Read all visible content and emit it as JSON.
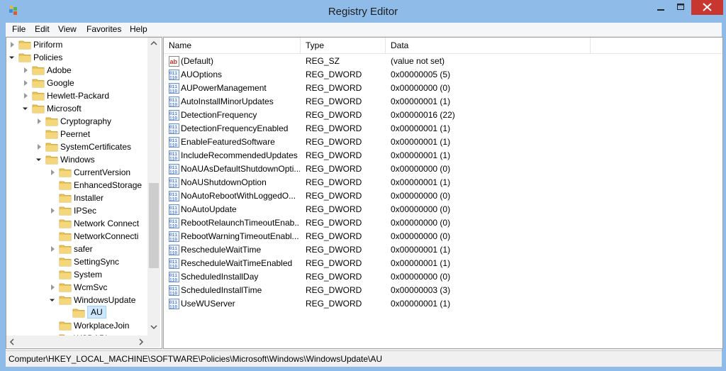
{
  "window": {
    "title": "Registry Editor"
  },
  "menu": [
    "File",
    "Edit",
    "View",
    "Favorites",
    "Help"
  ],
  "tree": [
    {
      "label": "Piriform",
      "state": "collapsed",
      "depth": 0
    },
    {
      "label": "Policies",
      "state": "expanded",
      "depth": 0
    },
    {
      "label": "Adobe",
      "state": "collapsed",
      "depth": 1
    },
    {
      "label": "Google",
      "state": "collapsed",
      "depth": 1
    },
    {
      "label": "Hewlett-Packard",
      "state": "collapsed",
      "depth": 1
    },
    {
      "label": "Microsoft",
      "state": "expanded",
      "depth": 1
    },
    {
      "label": "Cryptography",
      "state": "collapsed",
      "depth": 2
    },
    {
      "label": "Peernet",
      "state": "none",
      "depth": 2
    },
    {
      "label": "SystemCertificates",
      "state": "collapsed",
      "depth": 2
    },
    {
      "label": "Windows",
      "state": "expanded",
      "depth": 2
    },
    {
      "label": "CurrentVersion",
      "state": "collapsed",
      "depth": 3
    },
    {
      "label": "EnhancedStorage",
      "state": "none",
      "depth": 3
    },
    {
      "label": "Installer",
      "state": "none",
      "depth": 3
    },
    {
      "label": "IPSec",
      "state": "collapsed",
      "depth": 3
    },
    {
      "label": "Network Connect",
      "state": "none",
      "depth": 3
    },
    {
      "label": "NetworkConnecti",
      "state": "none",
      "depth": 3
    },
    {
      "label": "safer",
      "state": "collapsed",
      "depth": 3
    },
    {
      "label": "SettingSync",
      "state": "none",
      "depth": 3
    },
    {
      "label": "System",
      "state": "none",
      "depth": 3
    },
    {
      "label": "WcmSvc",
      "state": "collapsed",
      "depth": 3
    },
    {
      "label": "WindowsUpdate",
      "state": "expanded",
      "depth": 3
    },
    {
      "label": "AU",
      "state": "none",
      "depth": 4,
      "selected": true
    },
    {
      "label": "WorkplaceJoin",
      "state": "none",
      "depth": 3
    },
    {
      "label": "WSDAPI",
      "state": "collapsed",
      "depth": 3
    }
  ],
  "columns": {
    "name": "Name",
    "type": "Type",
    "data": "Data"
  },
  "values": [
    {
      "icon": "string-value-icon",
      "name": "(Default)",
      "type": "REG_SZ",
      "data": "(value not set)"
    },
    {
      "icon": "dword-value-icon",
      "name": "AUOptions",
      "type": "REG_DWORD",
      "data": "0x00000005 (5)"
    },
    {
      "icon": "dword-value-icon",
      "name": "AUPowerManagement",
      "type": "REG_DWORD",
      "data": "0x00000000 (0)"
    },
    {
      "icon": "dword-value-icon",
      "name": "AutoInstallMinorUpdates",
      "type": "REG_DWORD",
      "data": "0x00000001 (1)"
    },
    {
      "icon": "dword-value-icon",
      "name": "DetectionFrequency",
      "type": "REG_DWORD",
      "data": "0x00000016 (22)"
    },
    {
      "icon": "dword-value-icon",
      "name": "DetectionFrequencyEnabled",
      "type": "REG_DWORD",
      "data": "0x00000001 (1)"
    },
    {
      "icon": "dword-value-icon",
      "name": "EnableFeaturedSoftware",
      "type": "REG_DWORD",
      "data": "0x00000001 (1)"
    },
    {
      "icon": "dword-value-icon",
      "name": "IncludeRecommendedUpdates",
      "type": "REG_DWORD",
      "data": "0x00000001 (1)"
    },
    {
      "icon": "dword-value-icon",
      "name": "NoAUAsDefaultShutdownOpti...",
      "type": "REG_DWORD",
      "data": "0x00000000 (0)"
    },
    {
      "icon": "dword-value-icon",
      "name": "NoAUShutdownOption",
      "type": "REG_DWORD",
      "data": "0x00000001 (1)"
    },
    {
      "icon": "dword-value-icon",
      "name": "NoAutoRebootWithLoggedO...",
      "type": "REG_DWORD",
      "data": "0x00000000 (0)"
    },
    {
      "icon": "dword-value-icon",
      "name": "NoAutoUpdate",
      "type": "REG_DWORD",
      "data": "0x00000000 (0)"
    },
    {
      "icon": "dword-value-icon",
      "name": "RebootRelaunchTimeoutEnab...",
      "type": "REG_DWORD",
      "data": "0x00000000 (0)"
    },
    {
      "icon": "dword-value-icon",
      "name": "RebootWarningTimeoutEnabl...",
      "type": "REG_DWORD",
      "data": "0x00000000 (0)"
    },
    {
      "icon": "dword-value-icon",
      "name": "RescheduleWaitTime",
      "type": "REG_DWORD",
      "data": "0x00000001 (1)"
    },
    {
      "icon": "dword-value-icon",
      "name": "RescheduleWaitTimeEnabled",
      "type": "REG_DWORD",
      "data": "0x00000001 (1)"
    },
    {
      "icon": "dword-value-icon",
      "name": "ScheduledInstallDay",
      "type": "REG_DWORD",
      "data": "0x00000000 (0)"
    },
    {
      "icon": "dword-value-icon",
      "name": "ScheduledInstallTime",
      "type": "REG_DWORD",
      "data": "0x00000003 (3)"
    },
    {
      "icon": "dword-value-icon",
      "name": "UseWUServer",
      "type": "REG_DWORD",
      "data": "0x00000001 (1)"
    }
  ],
  "status": {
    "path": "Computer\\HKEY_LOCAL_MACHINE\\SOFTWARE\\Policies\\Microsoft\\Windows\\WindowsUpdate\\AU"
  },
  "colors": {
    "titlebar": "#8fbbe8",
    "close": "#c7372f",
    "selection": "#cde8ff"
  }
}
